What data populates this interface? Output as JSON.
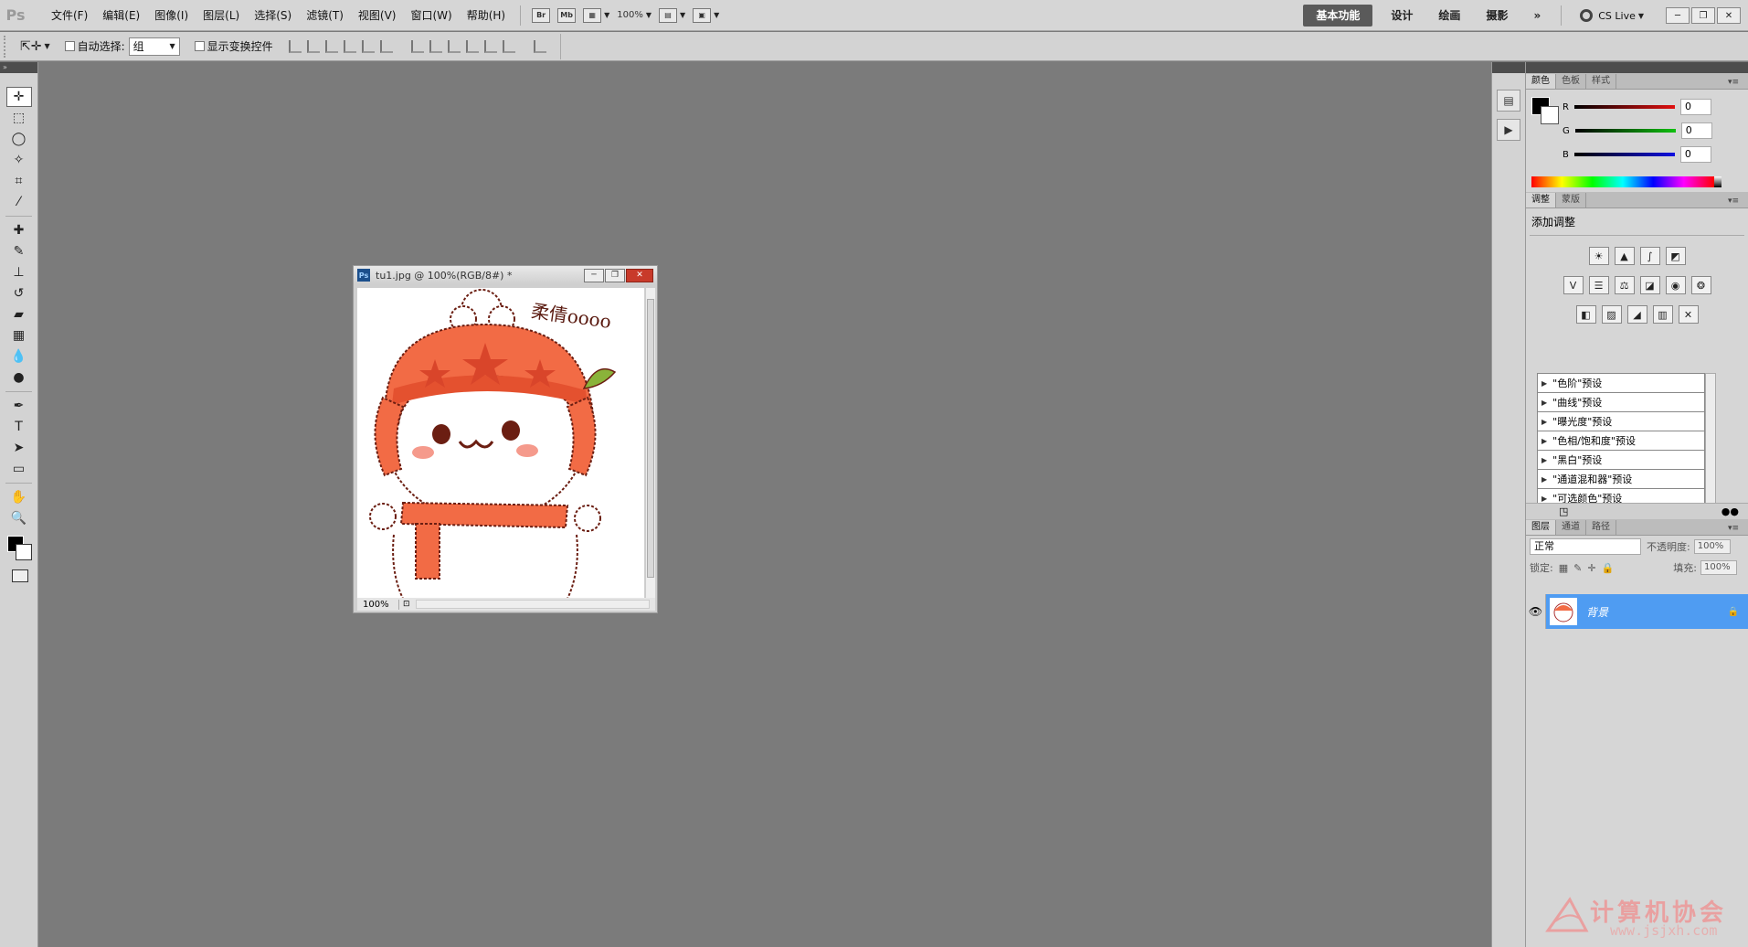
{
  "app": {
    "logo": "Ps"
  },
  "menu": [
    "文件(F)",
    "编辑(E)",
    "图像(I)",
    "图层(L)",
    "选择(S)",
    "滤镜(T)",
    "视图(V)",
    "窗口(W)",
    "帮助(H)"
  ],
  "menubar_buttons": {
    "bridge": "Br",
    "minibridge": "Mb",
    "zoom": "100%"
  },
  "workspaces": {
    "active": "基本功能",
    "items": [
      "设计",
      "绘画",
      "摄影"
    ],
    "more": "»"
  },
  "cslive": "CS Live",
  "options": {
    "auto_select_label": "自动选择:",
    "auto_select_value": "组",
    "show_transform_label": "显示变换控件"
  },
  "document": {
    "title": "tu1.jpg @ 100%(RGB/8#) *",
    "zoom": "100%",
    "handwriting": "柔倩oooo"
  },
  "color_panel": {
    "tabs": [
      "颜色",
      "色板",
      "样式"
    ],
    "r_label": "R",
    "g_label": "G",
    "b_label": "B",
    "r": "0",
    "g": "0",
    "b": "0",
    "colors": {
      "r_bar": "#e01010",
      "g_bar": "#10c010",
      "b_bar": "#1010e0"
    }
  },
  "adjust_panel": {
    "tabs": [
      "调整",
      "蒙版"
    ],
    "title": "添加调整",
    "presets": [
      "\"色阶\"预设",
      "\"曲线\"预设",
      "\"曝光度\"预设",
      "\"色相/饱和度\"预设",
      "\"黑白\"预设",
      "\"通道混和器\"预设",
      "\"可选颜色\"预设"
    ]
  },
  "layers_panel": {
    "tabs": [
      "图层",
      "通道",
      "路径"
    ],
    "blend_mode": "正常",
    "opacity_label": "不透明度:",
    "opacity": "100%",
    "lock_label": "锁定:",
    "fill_label": "填充:",
    "fill": "100%",
    "layer_name": "背景",
    "colors": {
      "selected": "#4f9cf2"
    }
  },
  "watermark": {
    "cn": "计算机协会",
    "url": "www.jsjxh.com"
  }
}
